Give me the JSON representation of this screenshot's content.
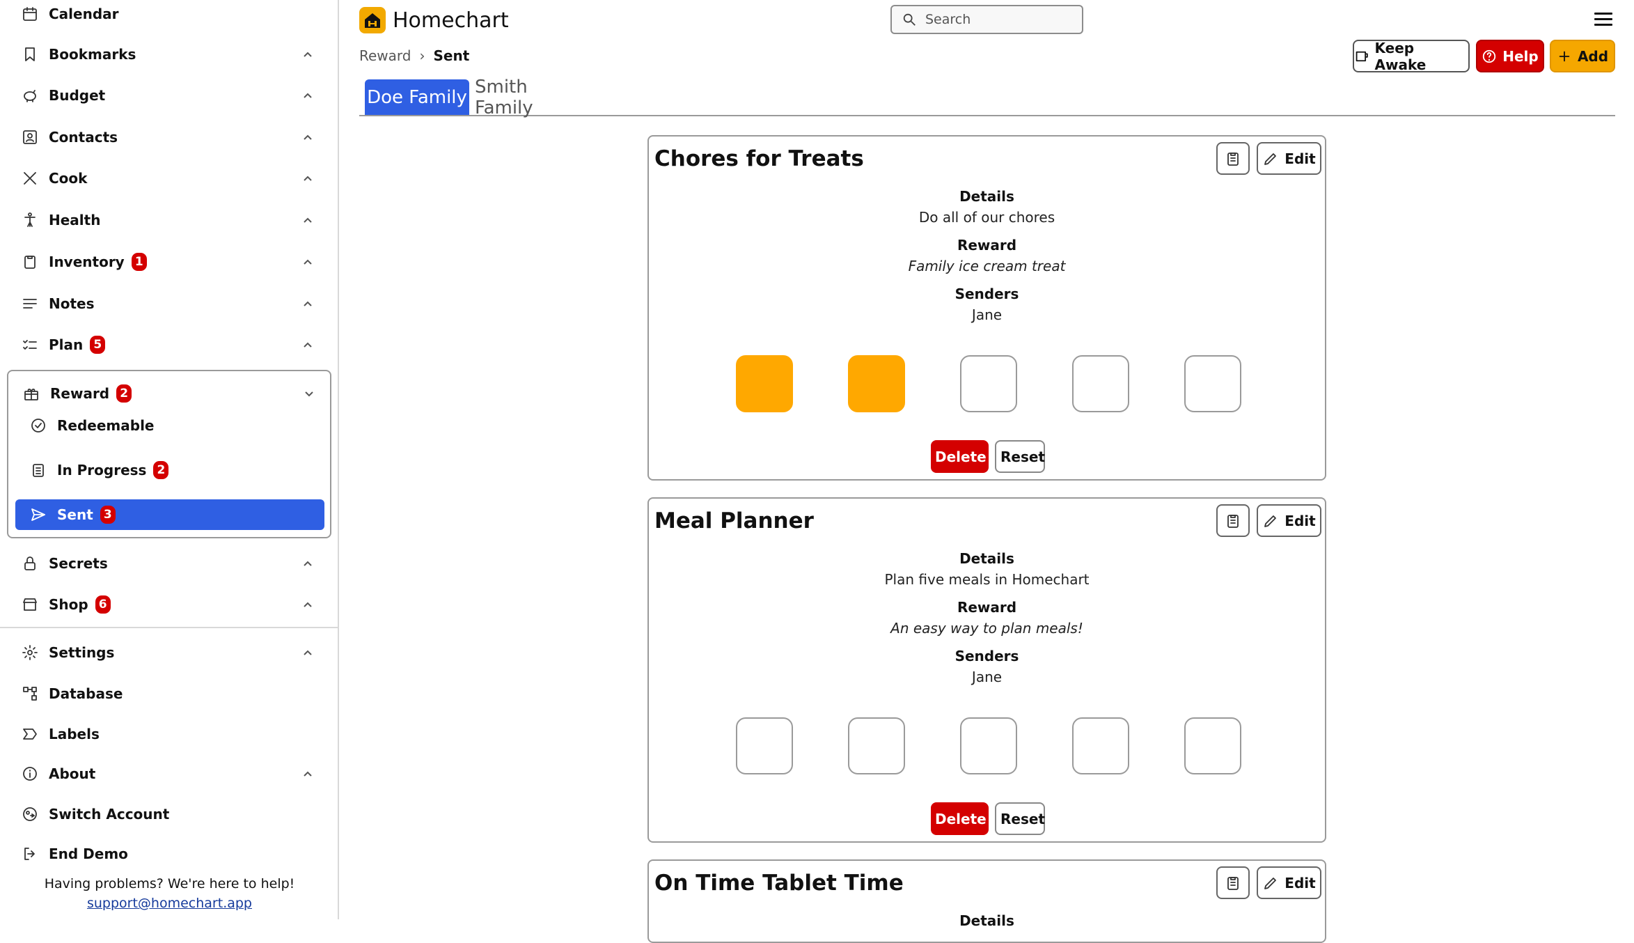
{
  "app": {
    "name": "Homechart",
    "brand_color": "#f2a900"
  },
  "search": {
    "placeholder": "Search"
  },
  "header": {
    "breadcrumb": {
      "parent": "Reward",
      "current": "Sent"
    },
    "buttons": {
      "keep_awake": "Keep Awake",
      "help": "Help",
      "add": "Add"
    }
  },
  "sidebar": {
    "items": [
      {
        "label": "Calendar",
        "icon": "calendar-icon"
      },
      {
        "label": "Bookmarks",
        "icon": "bookmark-icon"
      },
      {
        "label": "Budget",
        "icon": "piggy-bank-icon"
      },
      {
        "label": "Contacts",
        "icon": "contacts-icon"
      },
      {
        "label": "Cook",
        "icon": "utensils-icon"
      },
      {
        "label": "Health",
        "icon": "person-icon"
      },
      {
        "label": "Inventory",
        "icon": "clipboard-icon",
        "badge": "1"
      },
      {
        "label": "Notes",
        "icon": "notes-icon"
      },
      {
        "label": "Plan",
        "icon": "checklist-icon",
        "badge": "5"
      },
      {
        "label": "Reward",
        "icon": "gift-icon",
        "badge": "2"
      },
      {
        "label": "Secrets",
        "icon": "lock-icon"
      },
      {
        "label": "Shop",
        "icon": "store-icon",
        "badge": "6"
      },
      {
        "label": "Settings",
        "icon": "gear-icon"
      },
      {
        "label": "Database",
        "icon": "database-icon"
      },
      {
        "label": "Labels",
        "icon": "label-icon"
      },
      {
        "label": "About",
        "icon": "info-icon"
      },
      {
        "label": "Switch Account",
        "icon": "switch-account-icon"
      },
      {
        "label": "End Demo",
        "icon": "logout-icon"
      }
    ],
    "reward_sub": [
      {
        "label": "Redeemable",
        "icon": "check-circle-icon"
      },
      {
        "label": "In Progress",
        "icon": "list-icon",
        "badge": "2"
      },
      {
        "label": "Sent",
        "icon": "send-icon",
        "badge": "3"
      }
    ],
    "help_text": "Having problems? We're here to help!",
    "help_link": "support@homechart.app"
  },
  "tabs": [
    {
      "label": "Doe Family",
      "active": true
    },
    {
      "label": "Smith Family",
      "active": false
    }
  ],
  "labels": {
    "details": "Details",
    "reward": "Reward",
    "senders": "Senders",
    "edit": "Edit",
    "delete": "Delete",
    "reset": "Reset"
  },
  "cards": [
    {
      "title": "Chores for Treats",
      "details": "Do all of our chores",
      "reward": "Family ice cream treat",
      "senders": "Jane",
      "stamps_total": 5,
      "stamps_filled": 2
    },
    {
      "title": "Meal Planner",
      "details": "Plan five meals in Homechart",
      "reward": "An easy way to plan meals!",
      "senders": "Jane",
      "stamps_total": 5,
      "stamps_filled": 0
    },
    {
      "title": "On Time Tablet Time",
      "details": ""
    }
  ],
  "colors": {
    "accent": "#2f5fe3",
    "danger": "#d40000",
    "stamp": "#ffa800",
    "add": "#f5a700"
  }
}
